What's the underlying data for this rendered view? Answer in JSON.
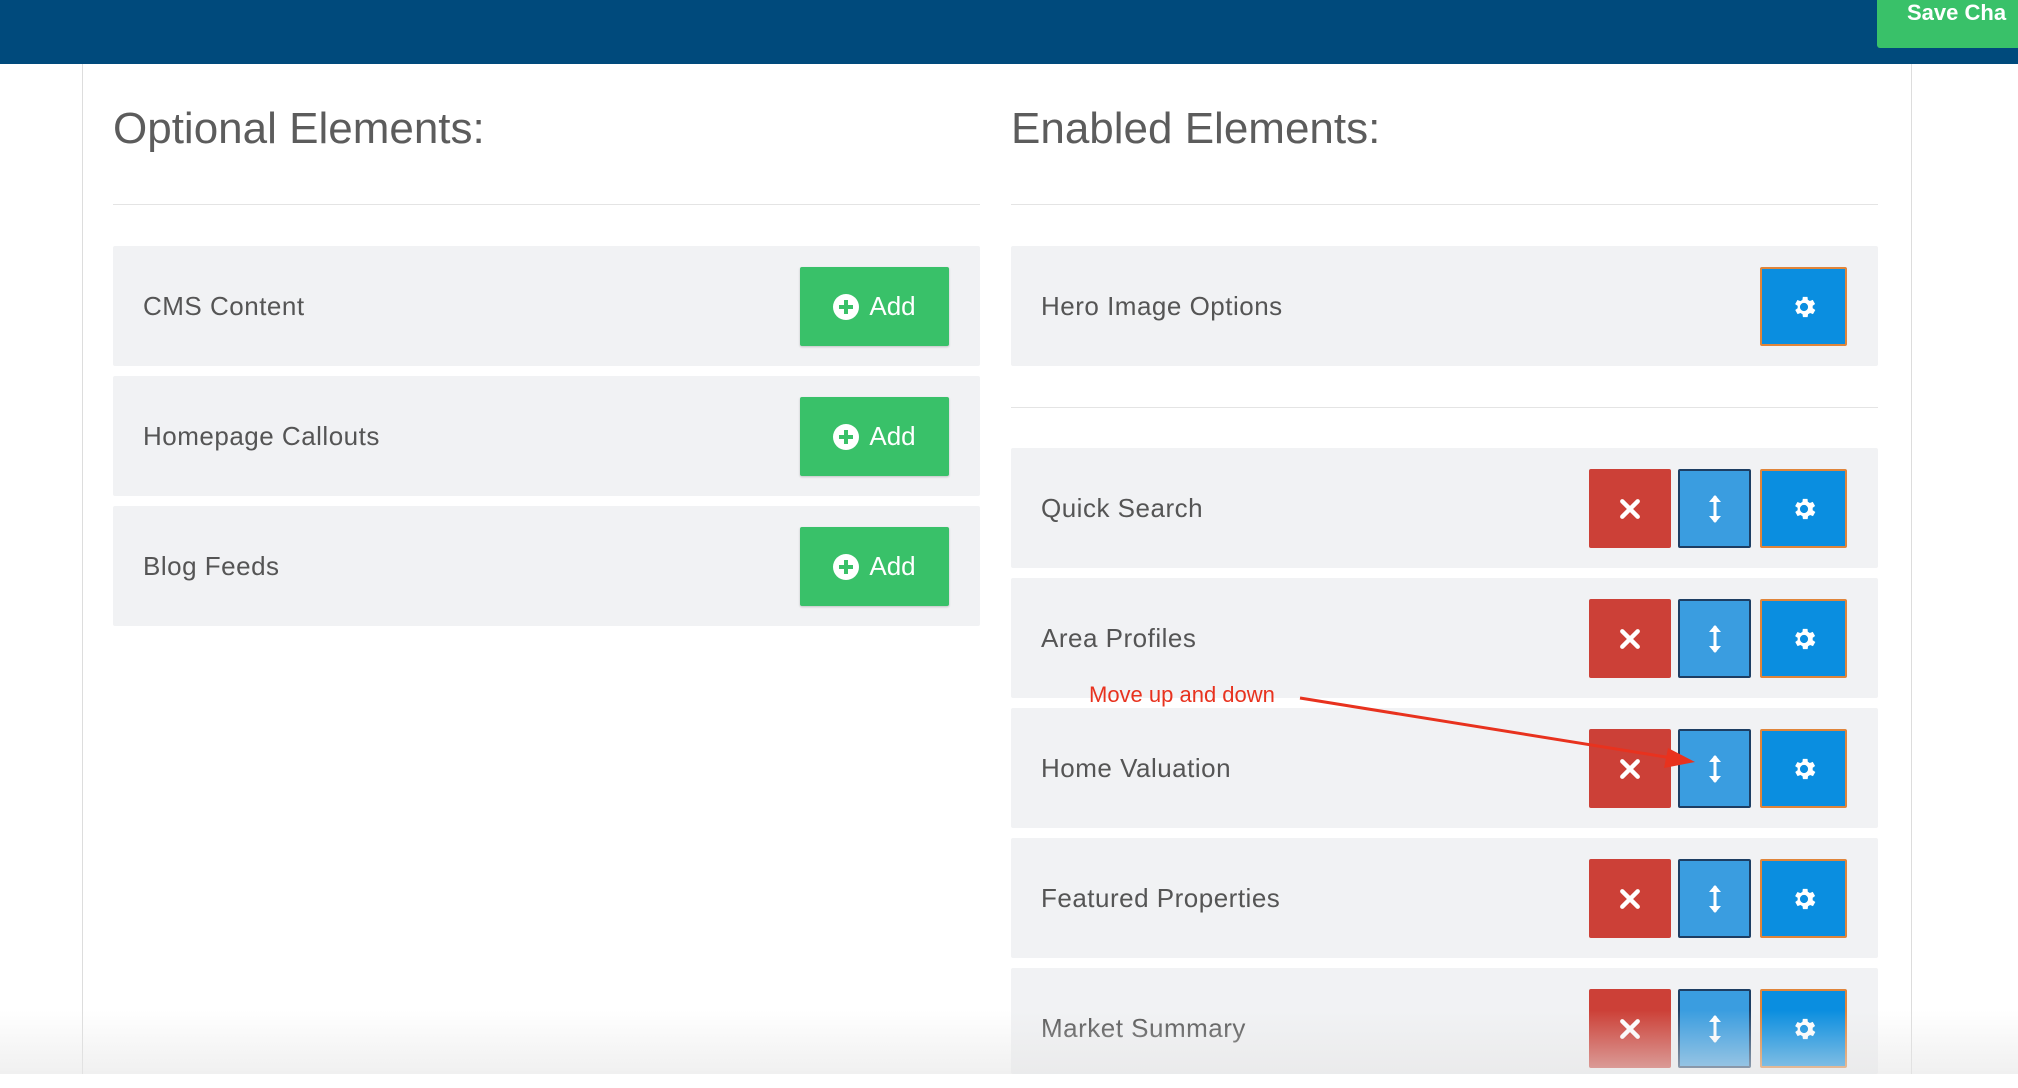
{
  "header": {
    "save_label": "Save Cha"
  },
  "optional": {
    "title": "Optional Elements:",
    "add_label": "Add",
    "items": [
      {
        "label": "CMS Content"
      },
      {
        "label": "Homepage Callouts"
      },
      {
        "label": "Blog Feeds"
      }
    ]
  },
  "enabled": {
    "title": "Enabled Elements:",
    "hero": {
      "label": "Hero Image Options"
    },
    "items": [
      {
        "label": "Quick Search"
      },
      {
        "label": "Area Profiles"
      },
      {
        "label": "Home Valuation"
      },
      {
        "label": "Featured Properties"
      },
      {
        "label": "Market Summary"
      }
    ]
  },
  "annotation": {
    "text": "Move up and down"
  },
  "colors": {
    "topbar": "#004a7c",
    "add_green": "#39c169",
    "delete_red": "#cc4037",
    "move_blue": "#3a9de0",
    "gear_blue": "#0a8ee0",
    "gear_border_orange": "#e0853a",
    "annotation_red": "#e8321e"
  },
  "icons": {
    "add": "plus-circle-icon",
    "delete": "close-icon",
    "move": "vertical-arrows-icon",
    "settings": "gear-icon"
  }
}
